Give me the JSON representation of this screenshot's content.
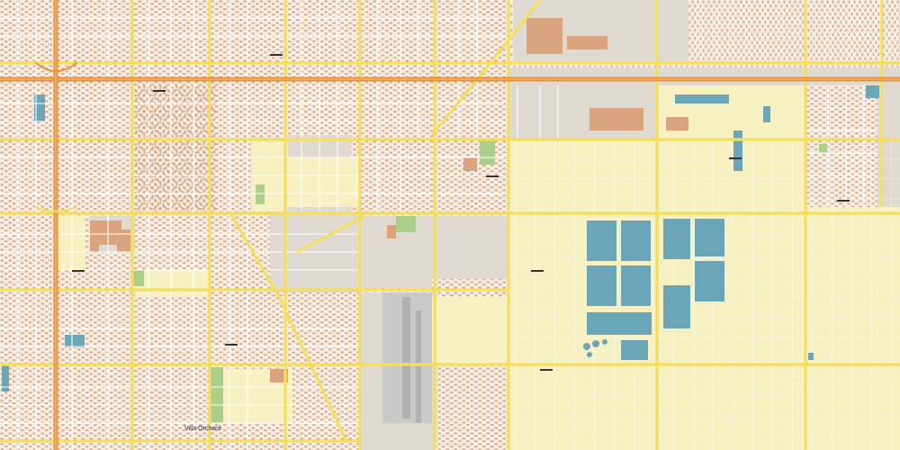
{
  "map": {
    "labels": {
      "villa_orchard": "Villa Orchard"
    },
    "colors": {
      "land_gray": "#dedad2",
      "residential": "#f3efe6",
      "building": "#d9a47d",
      "industrial_zone": "#f7f1c1",
      "road_major": "#f5dd5d",
      "road_minor": "#ffffff",
      "freeway": "#e8903c",
      "water": "#6aa5b8",
      "park": "#a9cf88",
      "airport": "#b9b9b9",
      "street_label": "#333333"
    }
  }
}
